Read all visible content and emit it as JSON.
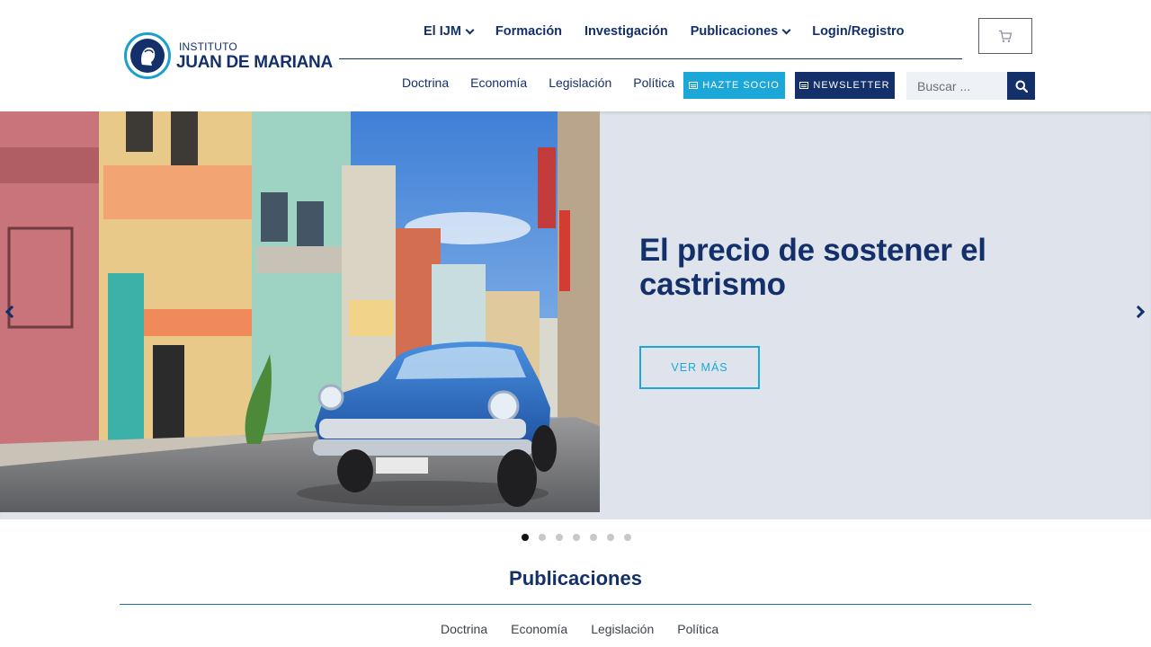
{
  "brand": {
    "line1": "INSTITUTO",
    "line2": "JUAN DE MARIANA",
    "color_primary": "#13306b",
    "color_accent": "#1ba8d8"
  },
  "main_nav": [
    {
      "label": "El IJM",
      "dropdown": true
    },
    {
      "label": "Formación",
      "dropdown": false
    },
    {
      "label": "Investigación",
      "dropdown": false
    },
    {
      "label": "Publicaciones",
      "dropdown": true
    },
    {
      "label": "Login/Registro",
      "dropdown": false
    }
  ],
  "sub_nav": [
    "Doctrina",
    "Economía",
    "Legislación",
    "Política"
  ],
  "buttons": {
    "socio": "HAZTE SOCIO",
    "newsletter": "NEWSLETTER"
  },
  "search": {
    "placeholder": "Buscar ..."
  },
  "icons": {
    "cart": "cart-icon",
    "search": "search-icon"
  },
  "hero": {
    "title": "El precio de sostener el castrismo",
    "cta": "VER MÁS",
    "slides_total": 7,
    "active_slide": 1
  },
  "publicaciones": {
    "title": "Publicaciones",
    "tabs": [
      "Doctrina",
      "Economía",
      "Legislación",
      "Política"
    ]
  }
}
